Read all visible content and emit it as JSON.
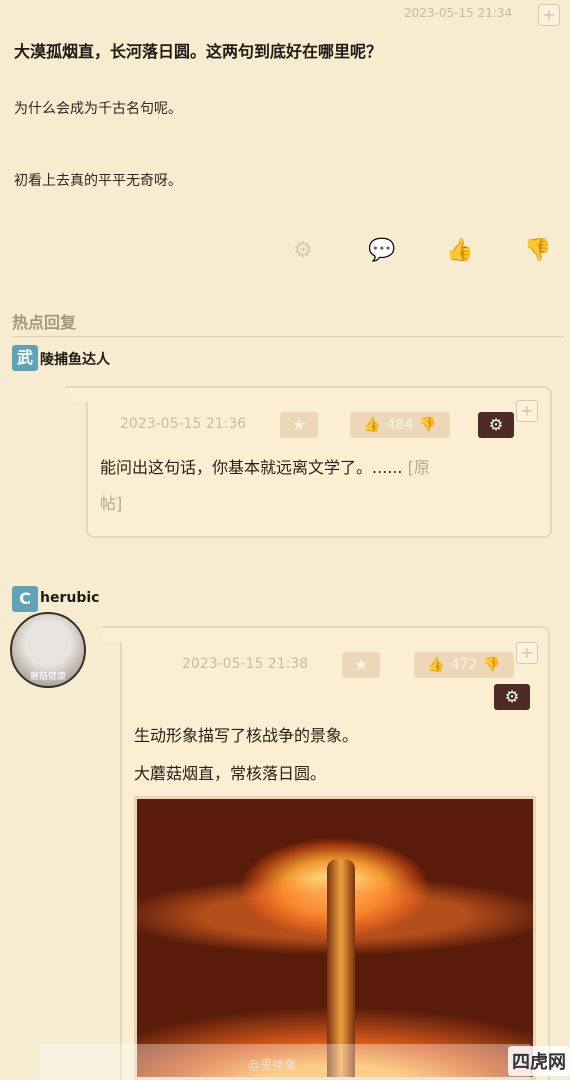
{
  "post": {
    "timestamp": "2023-05-15 21:34",
    "title": "大漠孤烟直，长河落日圆。这两句到底好在哪里呢？",
    "lines": [
      "为什么会成为千古名句呢。",
      "初看上去真的平平无奇呀。"
    ],
    "actions": [
      "gear-icon",
      "comment-icon",
      "thumbs-up-icon",
      "thumbs-down-icon"
    ]
  },
  "hot_replies": {
    "title": "热点回复",
    "replies": [
      {
        "badge": "武",
        "username": "陵捕鱼达人",
        "time": "2023-05-15 21:36",
        "votes": "484",
        "text": "能问出这句话，你基本就远离文学了。......",
        "link_a": "[原",
        "link_b": "帖]"
      },
      {
        "badge": "C",
        "username": "herubic",
        "avatar_caption": "蘑菇健康",
        "time": "2023-05-15 21:38",
        "votes": "472",
        "text_1": "生动形象描写了核战争的景象。",
        "text_2": "大蘑菇烟直，常核落日圆。"
      }
    ]
  },
  "watermark": {
    "left": "@里神楽",
    "right": "四虎网"
  },
  "colors": {
    "background": "#f8ecd0",
    "badge": "#5ea4b4",
    "gear_button": "#4c2c24"
  }
}
